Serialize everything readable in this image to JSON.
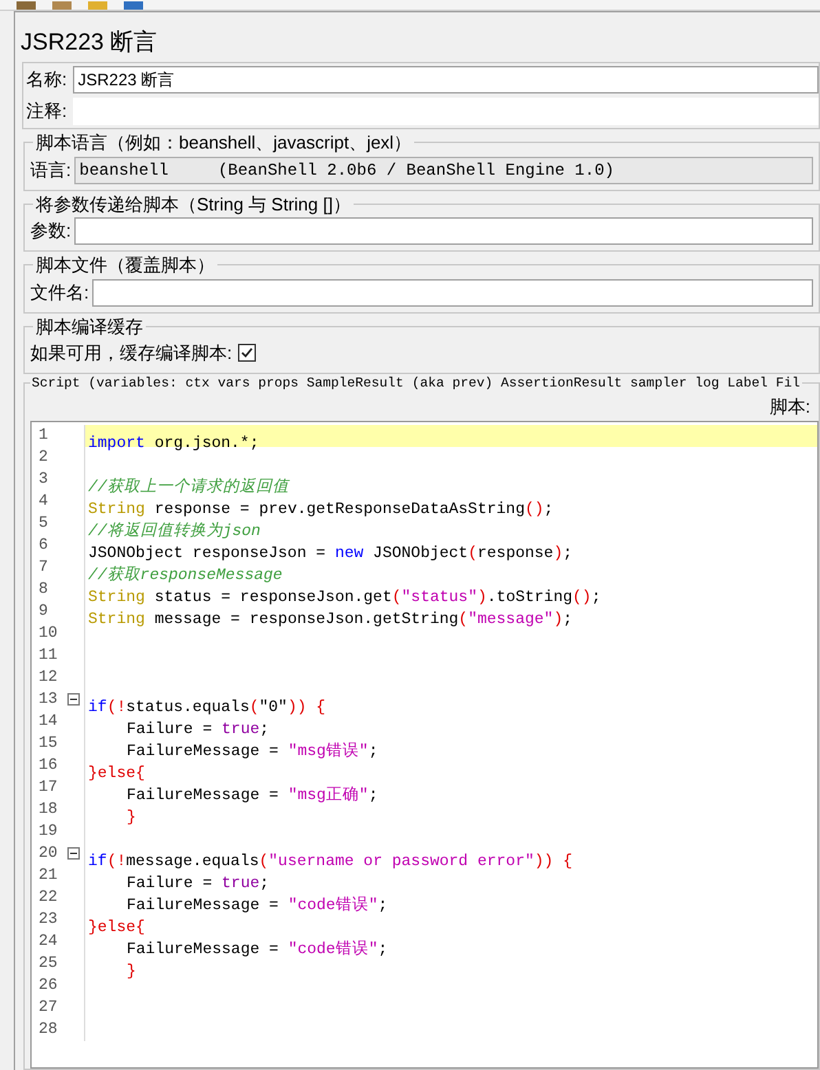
{
  "title": "JSR223 断言",
  "name_field": {
    "label": "名称:",
    "value": "JSR223 断言"
  },
  "comment_field": {
    "label": "注释:"
  },
  "language_group": {
    "legend": "脚本语言（例如：beanshell、javascript、jexl）",
    "label": "语言:",
    "value": "beanshell     (BeanShell 2.0b6 / BeanShell Engine 1.0)"
  },
  "parameters_group": {
    "legend": "将参数传递给脚本（String 与 String []）",
    "label": "参数:"
  },
  "file_group": {
    "legend": "脚本文件（覆盖脚本）",
    "label": "文件名:"
  },
  "cache_group": {
    "legend": "脚本编译缓存",
    "label": "如果可用，缓存编译脚本:",
    "checked": true
  },
  "script_group": {
    "legend": "Script (variables: ctx vars props SampleResult (aka prev) AssertionResult sampler log Label Fil",
    "label": "脚本:"
  },
  "code_lines": [
    {
      "number": "1",
      "current": true,
      "foldable": false,
      "indent": false,
      "tokens": [
        {
          "kind": "keyword",
          "text": "import"
        },
        {
          "kind": "plain",
          "text": " org.json.*;"
        }
      ]
    },
    {
      "number": "2",
      "current": false,
      "foldable": false
    },
    {
      "number": "3",
      "current": false,
      "foldable": false,
      "indent": false,
      "tokens": [
        {
          "kind": "comment",
          "text": "//获取上一个请求的返回值"
        }
      ]
    },
    {
      "number": "4",
      "current": false,
      "foldable": false,
      "indent": false,
      "tokens": [
        {
          "kind": "type",
          "text": "String"
        },
        {
          "kind": "plain",
          "text": " response = prev.getResponseDataAsString"
        },
        {
          "kind": "punct",
          "text": "()"
        },
        {
          "kind": "plain",
          "text": ";"
        }
      ]
    },
    {
      "number": "5",
      "current": false,
      "foldable": false,
      "indent": false,
      "tokens": [
        {
          "kind": "comment",
          "text": "//将返回值转换为json"
        }
      ]
    },
    {
      "number": "6",
      "current": false,
      "foldable": false,
      "indent": false,
      "tokens": [
        {
          "kind": "plain",
          "text": "JSONObject responseJson = "
        },
        {
          "kind": "keyword",
          "text": "new"
        },
        {
          "kind": "plain",
          "text": " JSONObject"
        },
        {
          "kind": "punct",
          "text": "("
        },
        {
          "kind": "plain",
          "text": "response"
        },
        {
          "kind": "punct",
          "text": ")"
        },
        {
          "kind": "plain",
          "text": ";"
        }
      ]
    },
    {
      "number": "7",
      "current": false,
      "foldable": false,
      "indent": false,
      "tokens": [
        {
          "kind": "comment",
          "text": "//获取responseMessage"
        }
      ]
    },
    {
      "number": "8",
      "current": false,
      "foldable": false,
      "indent": false,
      "tokens": [
        {
          "kind": "type",
          "text": "String"
        },
        {
          "kind": "plain",
          "text": " status = responseJson.get"
        },
        {
          "kind": "punct",
          "text": "("
        },
        {
          "kind": "string",
          "text": "\"status\""
        },
        {
          "kind": "punct",
          "text": ")"
        },
        {
          "kind": "plain",
          "text": ".toString"
        },
        {
          "kind": "punct",
          "text": "()"
        },
        {
          "kind": "plain",
          "text": ";"
        }
      ]
    },
    {
      "number": "9",
      "current": false,
      "foldable": false,
      "indent": false,
      "tokens": [
        {
          "kind": "type",
          "text": "String"
        },
        {
          "kind": "plain",
          "text": " message = responseJson.getString"
        },
        {
          "kind": "punct",
          "text": "("
        },
        {
          "kind": "string",
          "text": "\"message\""
        },
        {
          "kind": "punct",
          "text": ")"
        },
        {
          "kind": "plain",
          "text": ";"
        }
      ]
    },
    {
      "number": "10",
      "current": false,
      "foldable": false
    },
    {
      "number": "11",
      "current": false,
      "foldable": false
    },
    {
      "number": "12",
      "current": false,
      "foldable": false
    },
    {
      "number": "13",
      "current": false,
      "foldable": true,
      "indent": false,
      "tokens": [
        {
          "kind": "keyword",
          "text": "if"
        },
        {
          "kind": "punct",
          "text": "(!"
        },
        {
          "kind": "plain",
          "text": "status.equals"
        },
        {
          "kind": "punct",
          "text": "("
        },
        {
          "kind": "plain",
          "text": "\"0\""
        },
        {
          "kind": "punct",
          "text": ")) {"
        }
      ]
    },
    {
      "number": "14",
      "current": false,
      "foldable": false,
      "indent": true,
      "tokens": [
        {
          "kind": "plain",
          "text": "Failure = "
        },
        {
          "kind": "literal",
          "text": "true"
        },
        {
          "kind": "plain",
          "text": ";"
        }
      ]
    },
    {
      "number": "15",
      "current": false,
      "foldable": false,
      "indent": true,
      "tokens": [
        {
          "kind": "plain",
          "text": "FailureMessage = "
        },
        {
          "kind": "string",
          "text": "\"msg错误\""
        },
        {
          "kind": "plain",
          "text": ";"
        }
      ]
    },
    {
      "number": "16",
      "current": false,
      "foldable": false,
      "indent": false,
      "tokens": [
        {
          "kind": "punct",
          "text": "}else{"
        }
      ]
    },
    {
      "number": "17",
      "current": false,
      "foldable": false,
      "indent": true,
      "tokens": [
        {
          "kind": "plain",
          "text": "FailureMessage = "
        },
        {
          "kind": "string",
          "text": "\"msg正确\""
        },
        {
          "kind": "plain",
          "text": ";"
        }
      ]
    },
    {
      "number": "18",
      "current": false,
      "foldable": false,
      "indent": true,
      "tokens": [
        {
          "kind": "punct",
          "text": "}"
        }
      ]
    },
    {
      "number": "19",
      "current": false,
      "foldable": false
    },
    {
      "number": "20",
      "current": false,
      "foldable": true,
      "indent": false,
      "tokens": [
        {
          "kind": "keyword",
          "text": "if"
        },
        {
          "kind": "punct",
          "text": "(!"
        },
        {
          "kind": "plain",
          "text": "message.equals"
        },
        {
          "kind": "punct",
          "text": "("
        },
        {
          "kind": "string",
          "text": "\"username or password error\""
        },
        {
          "kind": "punct",
          "text": ")) {"
        }
      ]
    },
    {
      "number": "21",
      "current": false,
      "foldable": false,
      "indent": true,
      "tokens": [
        {
          "kind": "plain",
          "text": "Failure = "
        },
        {
          "kind": "literal",
          "text": "true"
        },
        {
          "kind": "plain",
          "text": ";"
        }
      ]
    },
    {
      "number": "22",
      "current": false,
      "foldable": false,
      "indent": true,
      "tokens": [
        {
          "kind": "plain",
          "text": "FailureMessage = "
        },
        {
          "kind": "string",
          "text": "\"code错误\""
        },
        {
          "kind": "plain",
          "text": ";"
        }
      ]
    },
    {
      "number": "23",
      "current": false,
      "foldable": false,
      "indent": false,
      "tokens": [
        {
          "kind": "punct",
          "text": "}else{"
        }
      ]
    },
    {
      "number": "24",
      "current": false,
      "foldable": false,
      "indent": true,
      "tokens": [
        {
          "kind": "plain",
          "text": "FailureMessage = "
        },
        {
          "kind": "string",
          "text": "\"code错误\""
        },
        {
          "kind": "plain",
          "text": ";"
        }
      ]
    },
    {
      "number": "25",
      "current": false,
      "foldable": false,
      "indent": true,
      "tokens": [
        {
          "kind": "punct",
          "text": "}"
        }
      ]
    },
    {
      "number": "26",
      "current": false,
      "foldable": false
    },
    {
      "number": "27",
      "current": false,
      "foldable": false
    },
    {
      "number": "28",
      "current": false,
      "foldable": false
    }
  ]
}
